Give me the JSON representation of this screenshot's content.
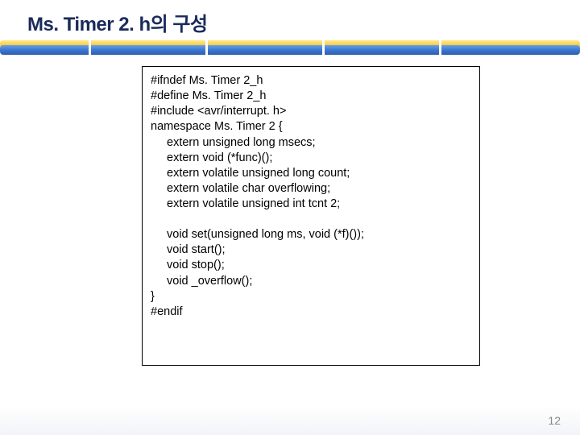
{
  "title": "Ms. Timer 2. h의 구성",
  "code": {
    "l1": "#ifndef Ms. Timer 2_h",
    "l2": "#define Ms. Timer 2_h",
    "l3": "#include <avr/interrupt. h>",
    "l4": "namespace Ms. Timer 2 {",
    "l5": "extern unsigned long msecs;",
    "l6": "extern void (*func)();",
    "l7": "extern volatile unsigned long count;",
    "l8": "extern volatile char overflowing;",
    "l9": "extern volatile unsigned int tcnt 2;",
    "l10": "void set(unsigned long ms, void (*f)());",
    "l11": "void start();",
    "l12": "void stop();",
    "l13": "void _overflow();",
    "l14": "}",
    "l15": "#endif"
  },
  "pagenum": "12"
}
